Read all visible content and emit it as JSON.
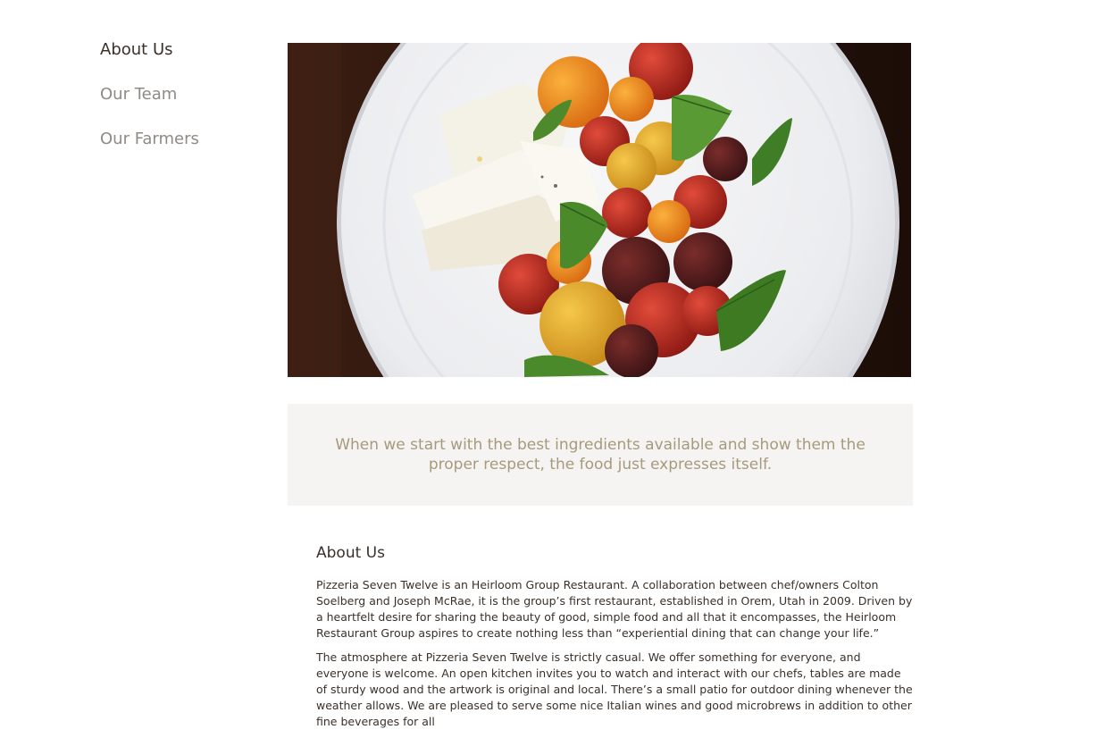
{
  "sidebar": {
    "items": [
      {
        "label": "About Us",
        "active": true
      },
      {
        "label": "Our Team",
        "active": false
      },
      {
        "label": "Our Farmers",
        "active": false
      }
    ]
  },
  "hero": {
    "image": "caprese-salad-plate"
  },
  "quote": {
    "text": "When we start with the best ingredients available and show them the proper respect, the food just expresses itself."
  },
  "about": {
    "heading": "About Us",
    "paragraphs": [
      "Pizzeria Seven Twelve is an Heirloom Group Restaurant. A collaboration between chef/owners Colton Soelberg and Joseph McRae, it is the group’s first restaurant, established in Orem, Utah in 2009. Driven by a heartfelt desire for sharing the beauty of good, simple food and all that it encompasses, the Heirloom Restaurant Group aspires to create nothing less than “experiential dining that can change your life.”",
      "The atmosphere at Pizzeria Seven Twelve is strictly casual. We offer something for everyone, and everyone is welcome. An open kitchen invites you to watch and interact with our chefs, tables are made of sturdy wood and the artwork is original and local. There’s a small patio for outdoor dining whenever the weather allows. We are pleased to serve some nice Italian wines and good microbrews in addition to other fine beverages for all"
    ]
  },
  "colors": {
    "nav_active": "#3a302a",
    "nav_inactive": "#8f8a85",
    "quote_text": "#a69a7c",
    "quote_background": "#f6f4f2",
    "body_text": "#3a302a"
  }
}
